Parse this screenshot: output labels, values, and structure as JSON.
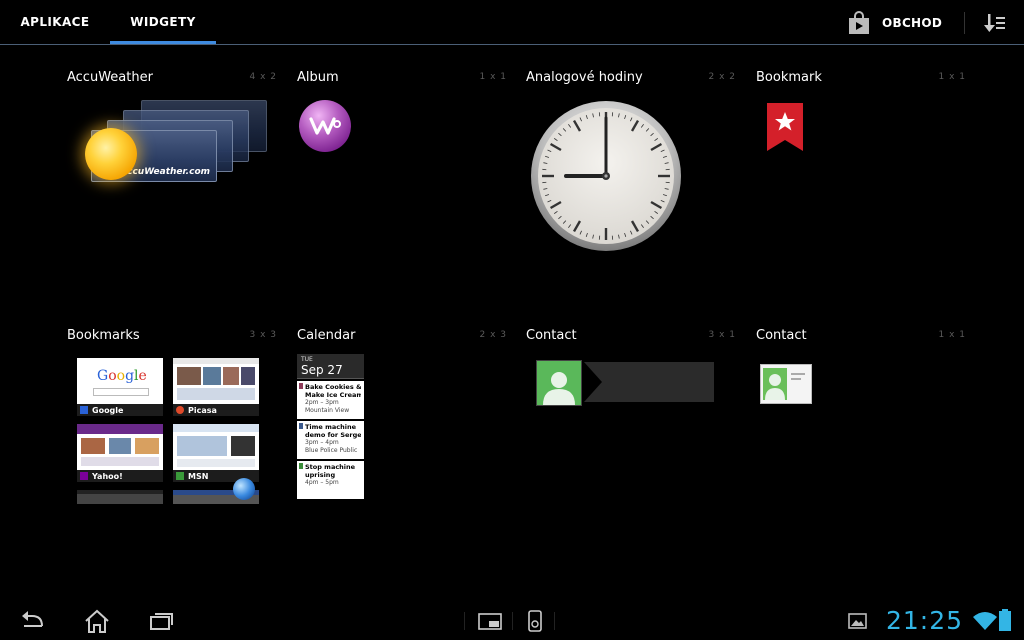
{
  "tabs": [
    {
      "label": "APLIKACE",
      "selected": false
    },
    {
      "label": "WIDGETY",
      "selected": true
    }
  ],
  "store": {
    "label": "OBCHOD",
    "icon": "shopping-bag-icon"
  },
  "sort_icon": "sort-menu-icon",
  "accent_color": "#3e8be0",
  "clock_color": "#33b5e5",
  "widgets": [
    {
      "name": "AccuWeather",
      "size": "4 x 2"
    },
    {
      "name": "Album",
      "size": "1 x 1"
    },
    {
      "name": "Analogové hodiny",
      "size": "2 x 2"
    },
    {
      "name": "Bookmark",
      "size": "1 x 1"
    },
    {
      "name": "Bookmarks",
      "size": "3 x 3"
    },
    {
      "name": "Calendar",
      "size": "2 x 3"
    },
    {
      "name": "Contact",
      "size": "3 x 1"
    },
    {
      "name": "Contact",
      "size": "1 x 1"
    }
  ],
  "accuweather_logo": "AccuWeather.com",
  "bookmarks": [
    {
      "name": "Google",
      "logo": "Google"
    },
    {
      "name": "Picasa"
    },
    {
      "name": "Yahoo!"
    },
    {
      "name": "MSN"
    }
  ],
  "calendar": {
    "day_of_week": "TUE",
    "date": "Sep 27",
    "events": [
      {
        "title": "Bake Cookies &",
        "title2": "Make Ice Cream",
        "time": "2pm – 3pm",
        "place": "Mountain View",
        "color": "#8e3b5a"
      },
      {
        "title": "Time machine",
        "title2": "demo for Sergey",
        "time": "3pm – 4pm",
        "place": "Blue Police Public",
        "color": "#3b5a8e"
      },
      {
        "title": "Stop machine",
        "title2": "uprising",
        "time": "4pm – 5pm",
        "place": "",
        "color": "#3b8e3b"
      }
    ]
  },
  "system_bar": {
    "time": "21:25",
    "nav_icons": [
      "back-icon",
      "home-icon",
      "recent-apps-icon"
    ],
    "status_icons": [
      "gallery-notification-icon",
      "wifi-icon",
      "battery-icon"
    ]
  }
}
